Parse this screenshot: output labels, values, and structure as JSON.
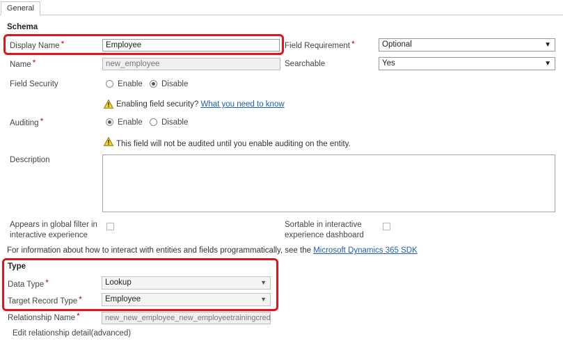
{
  "tabs": {
    "general": "General"
  },
  "schema": {
    "heading": "Schema",
    "display_name_label": "Display Name",
    "display_name_value": "Employee",
    "field_requirement_label": "Field Requirement",
    "field_requirement_value": "Optional",
    "name_label": "Name",
    "name_value": "new_employee",
    "searchable_label": "Searchable",
    "searchable_value": "Yes",
    "field_security_label": "Field Security",
    "field_security_enable": "Enable",
    "field_security_disable": "Disable",
    "field_security_selected": "Disable",
    "field_security_warning": "Enabling field security?",
    "field_security_link": "What you need to know",
    "auditing_label": "Auditing",
    "auditing_enable": "Enable",
    "auditing_disable": "Disable",
    "auditing_selected": "Enable",
    "auditing_warning": "This field will not be audited until you enable auditing on the entity.",
    "description_label": "Description",
    "global_filter_label_line1": "Appears in global filter in",
    "global_filter_label_line2": "interactive experience",
    "sortable_label_line1": "Sortable in interactive",
    "sortable_label_line2": "experience dashboard",
    "info_text": "For information about how to interact with entities and fields programmatically, see the",
    "info_link": "Microsoft Dynamics 365 SDK"
  },
  "type": {
    "heading": "Type",
    "data_type_label": "Data Type",
    "data_type_value": "Lookup",
    "target_record_type_label": "Target Record Type",
    "target_record_type_value": "Employee",
    "relationship_name_label": "Relationship Name",
    "relationship_name_value": "new_new_employee_new_employeetrainingcredit",
    "edit_relationship_label": "Edit relationship detail(advanced)"
  },
  "icons": {
    "dropdown_arrow": "▼",
    "required_marker": "*",
    "warning": "warning-icon"
  },
  "colors": {
    "highlight": "#e8101b",
    "required": "#c00000",
    "link": "#1f5ea8",
    "warning_fill": "#f5d21c"
  }
}
